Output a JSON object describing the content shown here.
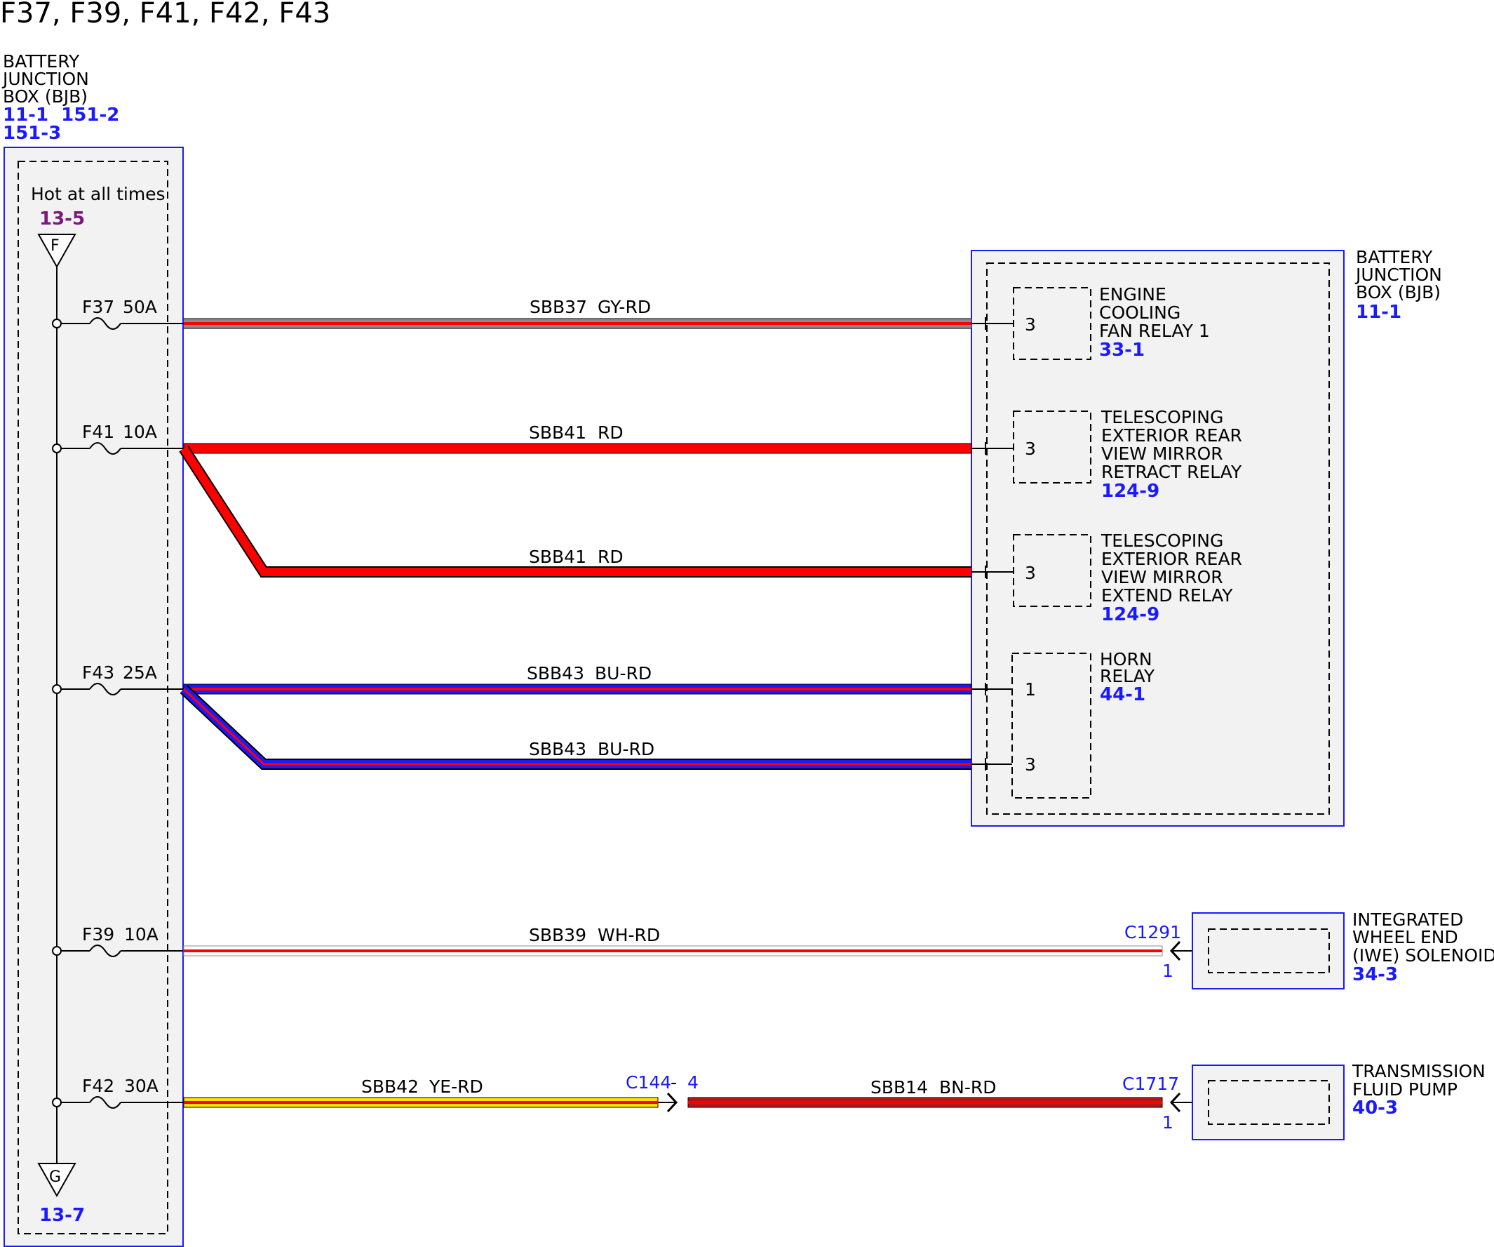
{
  "title": "F37, F39, F41, F42, F43",
  "bjb_left": {
    "lines": [
      "BATTERY",
      "JUNCTION",
      "BOX (BJB)"
    ],
    "refs": [
      "11-1  151-2",
      "151-3"
    ],
    "hot_label": "Hot at all times",
    "top_ref": "13-5",
    "top_letter": "F",
    "bottom_letter": "G",
    "bottom_ref": "13-7"
  },
  "fuses": [
    {
      "name": "F37",
      "amps": "50A"
    },
    {
      "name": "F41",
      "amps": "10A"
    },
    {
      "name": "F43",
      "amps": "25A"
    },
    {
      "name": "F39",
      "amps": "10A"
    },
    {
      "name": "F42",
      "amps": "30A"
    }
  ],
  "wires": [
    {
      "circuit": "SBB37",
      "color": "GY-RD"
    },
    {
      "circuit": "SBB41",
      "color": "RD"
    },
    {
      "circuit": "SBB41",
      "color": "RD"
    },
    {
      "circuit": "SBB43",
      "color": "BU-RD"
    },
    {
      "circuit": "SBB43",
      "color": "BU-RD"
    },
    {
      "circuit": "SBB39",
      "color": "WH-RD"
    },
    {
      "circuit": "SBB42",
      "color": "YE-RD"
    },
    {
      "circuit": "SBB14",
      "color": "BN-RD"
    }
  ],
  "bjb_right": {
    "lines": [
      "BATTERY",
      "JUNCTION",
      "BOX (BJB)"
    ],
    "ref": "11-1"
  },
  "relays": [
    {
      "lines": [
        "ENGINE",
        "COOLING",
        "FAN RELAY 1"
      ],
      "ref": "33-1",
      "pins": [
        "3"
      ]
    },
    {
      "lines": [
        "TELESCOPING",
        "EXTERIOR REAR",
        "VIEW MIRROR",
        "RETRACT RELAY"
      ],
      "ref": "124-9",
      "pins": [
        "3"
      ]
    },
    {
      "lines": [
        "TELESCOPING",
        "EXTERIOR REAR",
        "VIEW MIRROR",
        "EXTEND RELAY"
      ],
      "ref": "124-9",
      "pins": [
        "3"
      ]
    },
    {
      "lines": [
        "HORN",
        "RELAY"
      ],
      "ref": "44-1",
      "pins": [
        "1",
        "3"
      ]
    }
  ],
  "components": [
    {
      "lines": [
        "INTEGRATED",
        "WHEEL END",
        "(IWE) SOLENOID"
      ],
      "ref": "34-3",
      "connector": "C1291",
      "pin": "1"
    },
    {
      "lines": [
        "TRANSMISSION",
        "FLUID PUMP"
      ],
      "ref": "40-3",
      "connector": "C1717",
      "pin": "1"
    }
  ],
  "inline_connector": {
    "name": "C144",
    "pin": "4"
  },
  "wire_colors": {
    "gray": "#8c8c8c",
    "red": "#ff0000",
    "blue": "#1a1aff",
    "white": "#ffffff",
    "yellow": "#ffe000",
    "brown": "#b01818"
  }
}
